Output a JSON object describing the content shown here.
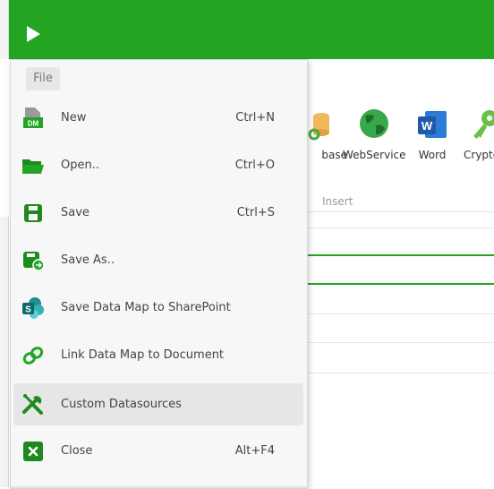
{
  "ribbon": {
    "items": [
      {
        "label": "base"
      },
      {
        "label": "WebService"
      },
      {
        "label": "Word"
      },
      {
        "label": "Crypto"
      }
    ],
    "group_label": "Insert"
  },
  "file_menu": {
    "tab_label": "File",
    "items": [
      {
        "label": "New",
        "shortcut": "Ctrl+N",
        "icon": "new-datamap-icon"
      },
      {
        "label": "Open..",
        "shortcut": "Ctrl+O",
        "icon": "folder-open-icon"
      },
      {
        "label": "Save",
        "shortcut": "Ctrl+S",
        "icon": "save-icon"
      },
      {
        "label": "Save As..",
        "shortcut": "",
        "icon": "save-as-icon"
      },
      {
        "label": "Save Data Map to SharePoint",
        "shortcut": "",
        "icon": "sharepoint-icon"
      },
      {
        "label": "Link Data Map to Document",
        "shortcut": "",
        "icon": "link-icon"
      },
      {
        "label": "Custom Datasources",
        "shortcut": "",
        "icon": "tools-icon"
      },
      {
        "label": "Close",
        "shortcut": "Alt+F4",
        "icon": "close-icon"
      }
    ],
    "active_item": "Custom Datasources"
  },
  "colors": {
    "accent": "#23a523",
    "menu_bg": "#f7f7f7",
    "active_bg": "#e6e6e6"
  }
}
